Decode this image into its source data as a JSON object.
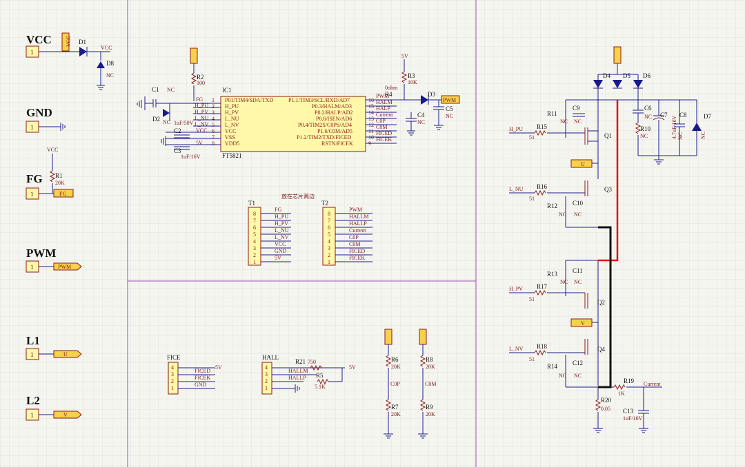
{
  "ports": [
    {
      "name": "VCC",
      "pin": "1",
      "net": "VCC"
    },
    {
      "name": "GND",
      "pin": "1",
      "net": ""
    },
    {
      "name": "FG",
      "pin": "1",
      "net": "FG"
    },
    {
      "name": "PWM",
      "pin": "1",
      "net": "PWM"
    },
    {
      "name": "L1",
      "pin": "1",
      "net": "U"
    },
    {
      "name": "L2",
      "pin": "1",
      "net": "V"
    }
  ],
  "left_col": {
    "d1": "D1",
    "d8": "D8",
    "vcc_net": "VCC",
    "nc": "NC",
    "r1": "R1",
    "r1_val": "20K",
    "vcc2": "VCC"
  },
  "ic1": {
    "ref": "IC1",
    "part": "FT5821",
    "left_pins": [
      "P01/TIM4/SDA/TXD",
      "H_PU",
      "H_PV",
      "L_NU",
      "L_NV",
      "VCC",
      "VSS",
      "VDD5"
    ],
    "left_nums": [
      "1",
      "2",
      "3",
      "4",
      "5",
      "6",
      "7",
      "8"
    ],
    "left_nets": [
      "FG",
      "H_PU",
      "H_PV",
      "L_NU",
      "L_NV",
      "VCC",
      "",
      ""
    ],
    "right_pins": [
      "P1.1/TIM3/SCL/RXD/AD7",
      "P0.3/HALM/AD3",
      "P0.2/HALP/AD2",
      "P0.6/ISEN/AD6",
      "P0.4/TIM2S/C0PS/AD4",
      "P1.6/C0M/AD5",
      "P1.2/TIM2/TXD/FICED",
      "RSTN/FICEK"
    ],
    "right_nums": [
      "16",
      "15",
      "14",
      "13",
      "12",
      "11",
      "10",
      "9"
    ],
    "right_nets": [
      "PWM",
      "HALM",
      "HALP",
      "Current",
      "C0P",
      "C0M",
      "FICED",
      "FICEK"
    ],
    "c1": "C1",
    "c1_val": "NC",
    "d2": "D2",
    "d2_val": "NC",
    "c2": "C2",
    "c2_val": "1uF/50V",
    "c3": "C3",
    "c3_val": "1uF/16V",
    "r2": "R2",
    "r2_val": "100",
    "r3": "R3",
    "r3_val": "10K",
    "r4": "R4",
    "r4_val": "0ohm",
    "d3": "D3",
    "c4": "C4",
    "c4_val": "NC",
    "c5": "C5",
    "c5_val": "NC",
    "fivev": "5V",
    "pwm_flag": "PWM"
  },
  "note": "放在芯片两边",
  "t1": {
    "ref": "T1",
    "nums": [
      "8",
      "7",
      "6",
      "5",
      "4",
      "3",
      "2",
      "1"
    ],
    "nets": [
      "FG",
      "H_PU",
      "H_PV",
      "L_NU",
      "L_NV",
      "VCC",
      "GND",
      "5V"
    ]
  },
  "t2": {
    "ref": "T2",
    "nums": [
      "8",
      "7",
      "6",
      "5",
      "4",
      "3",
      "2",
      "1"
    ],
    "nets": [
      "PWM",
      "HALLM",
      "HALLP",
      "Current",
      "C0P",
      "C0M",
      "FICED",
      "FICEK"
    ]
  },
  "fice": {
    "ref": "FICE",
    "nums": [
      "4",
      "3",
      "2",
      "1"
    ],
    "nets": [
      "FICED",
      "FICEK",
      "GND"
    ],
    "fivev": "5V"
  },
  "hall": {
    "ref": "HALL",
    "nums": [
      "4",
      "3",
      "2",
      "1"
    ],
    "nets": [
      "HALLM",
      "HALLP"
    ],
    "r21": "R21",
    "r21_val": "750",
    "r5": "R5",
    "r5_val": "5.1K",
    "fivev": "5V"
  },
  "dividers": {
    "r6": "R6",
    "r6_val": "20K",
    "r7": "R7",
    "r7_val": "20K",
    "c0p": "C0P",
    "r8": "R8",
    "r8_val": "20K",
    "r9": "R9",
    "r9_val": "20K",
    "c0m": "C0M"
  },
  "bridge": {
    "d4": "D4",
    "d5": "D5",
    "d6": "D6",
    "d7": "D7",
    "c6": "C6",
    "c7": "C7",
    "c7_val": "4.7uF/16V",
    "c8": "C8",
    "r10": "R10",
    "nc": "NC",
    "q1": "Q1",
    "q2": "Q2",
    "q3": "Q3",
    "q4": "Q4",
    "r15": "R15",
    "r16": "R16",
    "r17": "R17",
    "r18": "R18",
    "r51": "51",
    "r11": "R11",
    "r12": "R12",
    "r13": "R13",
    "r14": "R14",
    "c9": "C9",
    "c10": "C10",
    "c11": "C11",
    "c12": "C12",
    "h_pu": "H_PU",
    "l_nu": "L_NU",
    "h_pv": "H_PV",
    "l_nv": "L_NV",
    "u": "U",
    "v": "V",
    "r19": "R19",
    "r19_val": "1K",
    "current": "Current",
    "r20": "R20",
    "r20_val": "0.05",
    "c13": "C13",
    "c13_val": "1uF/16V"
  }
}
